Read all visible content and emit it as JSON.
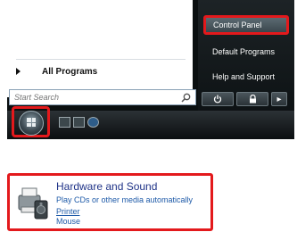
{
  "start_menu": {
    "all_programs_label": "All Programs",
    "search_placeholder": "Start Search",
    "right_items": [
      "Control Panel",
      "Default Programs",
      "Help and Support"
    ],
    "power_arrow": "▸"
  },
  "control_panel_item": {
    "title": "Hardware and Sound",
    "description": "Play CDs or other media automatically",
    "link": "Printer",
    "subitem": "Mouse"
  },
  "colors": {
    "highlight_border": "#e3191c",
    "taskbar": "#0b0e10",
    "link_blue": "#1e5aa8"
  }
}
